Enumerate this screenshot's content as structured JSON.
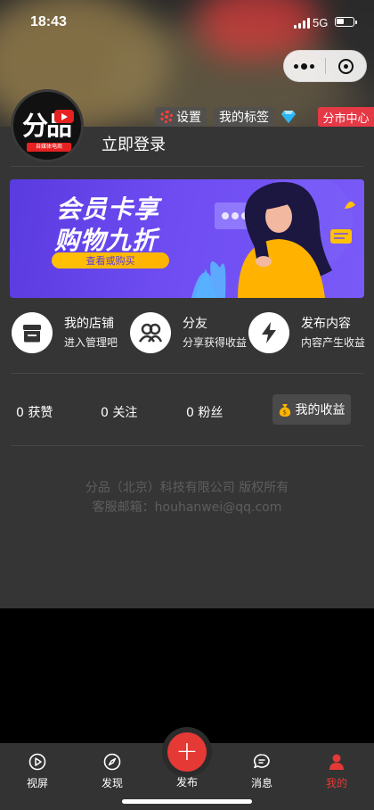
{
  "status": {
    "time": "18:43",
    "network": "5G",
    "battery_level": 0.45
  },
  "header": {
    "logo_text": "分品",
    "logo_strip": "自媒体电商",
    "settings_label": "设置",
    "tags_label": "我的标签",
    "distribution_label": "分市中心",
    "login_label": "立即登录"
  },
  "banner": {
    "title_line1": "会员卡享",
    "title_line2": "购物九折",
    "button_label": "查看或购买"
  },
  "shortcuts": [
    {
      "title": "我的店铺",
      "subtitle": "进入管理吧",
      "icon": "store-icon"
    },
    {
      "title": "分友",
      "subtitle": "分享获得收益",
      "icon": "friends-icon"
    },
    {
      "title": "发布内容",
      "subtitle": "内容产生收益",
      "icon": "lightning-icon"
    }
  ],
  "stats": {
    "likes": "0 获赞",
    "following": "0 关注",
    "fans": "0 粉丝",
    "earnings_label": "我的收益"
  },
  "footer": {
    "copyright": "分品（北京）科技有限公司 版权所有",
    "email": "客服邮箱：houhanwei@qq.com"
  },
  "tabbar": {
    "tabs": [
      {
        "label": "视屏",
        "icon": "play-circle-icon"
      },
      {
        "label": "发现",
        "icon": "compass-icon"
      },
      {
        "label": "发布",
        "icon": "plus-icon"
      },
      {
        "label": "消息",
        "icon": "message-icon"
      },
      {
        "label": "我的",
        "icon": "user-icon"
      }
    ],
    "active": "我的"
  },
  "colors": {
    "accent": "#e53935",
    "background": "#353535",
    "banner": "#6e4cf2"
  }
}
